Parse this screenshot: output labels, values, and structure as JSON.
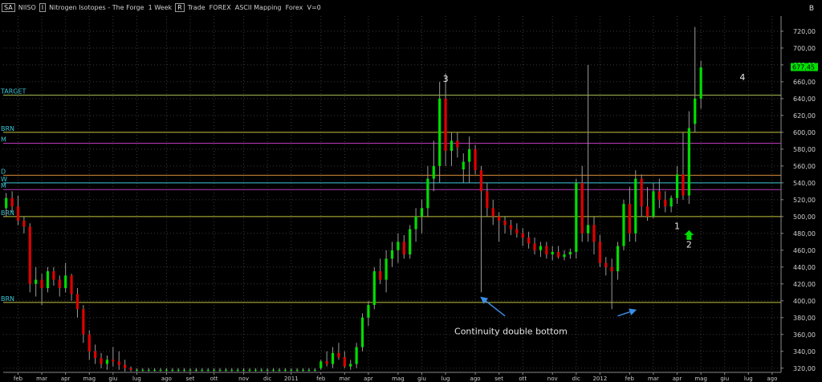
{
  "toolbar": {
    "symbol_box": "SA",
    "symbol": "NIISO",
    "name_box": "I",
    "instrument": "Nitrogen Isotopes - The Forge  1 Week",
    "mode_box": "R",
    "mode_text": "Trade  FOREX  ASCII Mapping  Forex  V=0",
    "corner": "B"
  },
  "chart_data": {
    "type": "candlestick",
    "title": "",
    "ylim": [
      315,
      738
    ],
    "y_ticks": [
      320,
      340,
      360,
      380,
      400,
      420,
      440,
      460,
      480,
      500,
      520,
      540,
      560,
      580,
      600,
      620,
      640,
      660,
      680,
      700,
      720
    ],
    "y_tick_labels": [
      "320,00",
      "340,00",
      "360,00",
      "380,00",
      "400,00",
      "420,00",
      "440,00",
      "460,00",
      "480,00",
      "500,00",
      "520,00",
      "540,00",
      "560,00",
      "580,00",
      "600,00",
      "620,00",
      "640,00",
      "660,00",
      "680,00",
      "700,00",
      "720,00"
    ],
    "last_price": {
      "value": 677.45,
      "label": "677,45",
      "color": "#00e000"
    },
    "x_labels": [
      {
        "i": 2,
        "label": "feb"
      },
      {
        "i": 6,
        "label": "mar"
      },
      {
        "i": 10,
        "label": "apr"
      },
      {
        "i": 14,
        "label": "mag"
      },
      {
        "i": 18,
        "label": "giu"
      },
      {
        "i": 22,
        "label": "lug"
      },
      {
        "i": 27,
        "label": "ago"
      },
      {
        "i": 31,
        "label": "set"
      },
      {
        "i": 35,
        "label": "ott"
      },
      {
        "i": 40,
        "label": "nov"
      },
      {
        "i": 44,
        "label": "dic"
      },
      {
        "i": 48,
        "label": "2011"
      },
      {
        "i": 53,
        "label": "feb"
      },
      {
        "i": 57,
        "label": "mar"
      },
      {
        "i": 61,
        "label": "apr"
      },
      {
        "i": 66,
        "label": "mag"
      },
      {
        "i": 70,
        "label": "giu"
      },
      {
        "i": 74,
        "label": "lug"
      },
      {
        "i": 79,
        "label": "ago"
      },
      {
        "i": 83,
        "label": "set"
      },
      {
        "i": 87,
        "label": "ott"
      },
      {
        "i": 92,
        "label": "nov"
      },
      {
        "i": 96,
        "label": "dic"
      },
      {
        "i": 100,
        "label": "2012"
      },
      {
        "i": 105,
        "label": "feb"
      },
      {
        "i": 109,
        "label": "mar"
      },
      {
        "i": 113,
        "label": "apr"
      },
      {
        "i": 117,
        "label": "mag"
      },
      {
        "i": 121,
        "label": "giu"
      },
      {
        "i": 125,
        "label": "lug"
      },
      {
        "i": 129,
        "label": "ago"
      }
    ],
    "ohlc": [
      [
        510,
        528,
        500,
        522
      ],
      [
        522,
        530,
        505,
        512
      ],
      [
        512,
        525,
        490,
        495
      ],
      [
        495,
        500,
        480,
        488
      ],
      [
        488,
        492,
        410,
        420
      ],
      [
        420,
        440,
        405,
        425
      ],
      [
        425,
        432,
        395,
        415
      ],
      [
        415,
        440,
        410,
        435
      ],
      [
        435,
        440,
        418,
        425
      ],
      [
        425,
        430,
        405,
        415
      ],
      [
        415,
        445,
        410,
        430
      ],
      [
        430,
        432,
        400,
        408
      ],
      [
        408,
        415,
        380,
        390
      ],
      [
        390,
        395,
        350,
        360
      ],
      [
        360,
        365,
        330,
        340
      ],
      [
        340,
        348,
        325,
        332
      ],
      [
        332,
        338,
        320,
        325
      ],
      [
        325,
        335,
        318,
        330
      ],
      [
        330,
        345,
        322,
        328
      ],
      [
        328,
        340,
        318,
        324
      ],
      [
        324,
        330,
        316,
        320
      ],
      [
        320,
        322,
        316,
        318
      ],
      [
        318,
        320,
        316,
        318
      ],
      [
        318,
        320,
        316,
        318
      ],
      [
        318,
        320,
        316,
        318
      ],
      [
        318,
        320,
        316,
        318
      ],
      [
        318,
        320,
        316,
        318
      ],
      [
        318,
        320,
        316,
        318
      ],
      [
        318,
        320,
        316,
        318
      ],
      [
        318,
        320,
        316,
        318
      ],
      [
        318,
        320,
        316,
        318
      ],
      [
        318,
        320,
        316,
        318
      ],
      [
        318,
        320,
        316,
        318
      ],
      [
        318,
        320,
        316,
        318
      ],
      [
        318,
        320,
        316,
        318
      ],
      [
        318,
        320,
        316,
        318
      ],
      [
        318,
        320,
        316,
        318
      ],
      [
        318,
        320,
        316,
        318
      ],
      [
        318,
        320,
        316,
        318
      ],
      [
        318,
        320,
        316,
        318
      ],
      [
        318,
        320,
        316,
        318
      ],
      [
        318,
        320,
        316,
        318
      ],
      [
        318,
        320,
        316,
        318
      ],
      [
        318,
        320,
        316,
        318
      ],
      [
        318,
        320,
        316,
        318
      ],
      [
        318,
        320,
        316,
        318
      ],
      [
        318,
        320,
        316,
        318
      ],
      [
        318,
        320,
        316,
        318
      ],
      [
        318,
        320,
        316,
        318
      ],
      [
        318,
        320,
        316,
        318
      ],
      [
        318,
        320,
        316,
        318
      ],
      [
        318,
        320,
        316,
        318
      ],
      [
        318,
        320,
        316,
        318
      ],
      [
        320,
        330,
        318,
        328
      ],
      [
        328,
        340,
        322,
        325
      ],
      [
        325,
        345,
        320,
        338
      ],
      [
        338,
        350,
        330,
        333
      ],
      [
        333,
        340,
        320,
        322
      ],
      [
        322,
        330,
        318,
        325
      ],
      [
        325,
        350,
        320,
        345
      ],
      [
        345,
        385,
        340,
        380
      ],
      [
        380,
        400,
        370,
        395
      ],
      [
        395,
        440,
        390,
        435
      ],
      [
        435,
        450,
        420,
        425
      ],
      [
        425,
        460,
        410,
        450
      ],
      [
        450,
        470,
        440,
        460
      ],
      [
        460,
        480,
        445,
        470
      ],
      [
        470,
        478,
        450,
        455
      ],
      [
        455,
        490,
        450,
        485
      ],
      [
        485,
        510,
        470,
        500
      ],
      [
        500,
        520,
        480,
        510
      ],
      [
        510,
        560,
        500,
        545
      ],
      [
        545,
        590,
        530,
        560
      ],
      [
        560,
        660,
        540,
        640
      ],
      [
        640,
        670,
        560,
        578
      ],
      [
        578,
        600,
        560,
        590
      ],
      [
        590,
        600,
        570,
        582
      ],
      [
        556,
        575,
        540,
        565
      ],
      [
        565,
        595,
        540,
        580
      ],
      [
        580,
        585,
        550,
        555
      ],
      [
        555,
        560,
        410,
        530
      ],
      [
        530,
        540,
        500,
        510
      ],
      [
        510,
        520,
        490,
        500
      ],
      [
        500,
        505,
        470,
        495
      ],
      [
        495,
        500,
        480,
        490
      ],
      [
        490,
        496,
        478,
        485
      ],
      [
        485,
        492,
        475,
        480
      ],
      [
        480,
        486,
        465,
        475
      ],
      [
        475,
        482,
        462,
        468
      ],
      [
        468,
        475,
        455,
        460
      ],
      [
        460,
        470,
        452,
        465
      ],
      [
        465,
        470,
        450,
        455
      ],
      [
        455,
        465,
        448,
        458
      ],
      [
        458,
        465,
        450,
        452
      ],
      [
        452,
        460,
        448,
        455
      ],
      [
        455,
        462,
        450,
        458
      ],
      [
        458,
        545,
        450,
        540
      ],
      [
        540,
        560,
        470,
        480
      ],
      [
        480,
        680,
        470,
        490
      ],
      [
        490,
        500,
        455,
        470
      ],
      [
        470,
        478,
        440,
        445
      ],
      [
        445,
        452,
        430,
        440
      ],
      [
        440,
        450,
        390,
        435
      ],
      [
        435,
        470,
        425,
        465
      ],
      [
        465,
        520,
        460,
        515
      ],
      [
        515,
        535,
        470,
        480
      ],
      [
        480,
        555,
        470,
        545
      ],
      [
        545,
        550,
        500,
        512
      ],
      [
        512,
        535,
        495,
        500
      ],
      [
        500,
        540,
        498,
        530
      ],
      [
        530,
        545,
        510,
        520
      ],
      [
        520,
        530,
        505,
        512
      ],
      [
        512,
        525,
        505,
        522
      ],
      [
        522,
        560,
        515,
        550
      ],
      [
        550,
        600,
        520,
        525
      ],
      [
        525,
        625,
        515,
        605
      ],
      [
        610,
        725,
        600,
        640
      ],
      [
        640,
        685,
        628,
        677
      ]
    ],
    "levels": [
      {
        "value": 644,
        "label": "TARGET",
        "color": "#a8c254"
      },
      {
        "value": 600,
        "label": "BRN",
        "color": "#c2c23c"
      },
      {
        "value": 587,
        "label": "M",
        "color": "#b83ab8"
      },
      {
        "value": 549,
        "label": "D",
        "color": "#d88a3a"
      },
      {
        "value": 540,
        "label": "W",
        "color": "#3ac6d8"
      },
      {
        "value": 532,
        "label": "M",
        "color": "#b83ab8"
      },
      {
        "value": 500,
        "label": "BRN",
        "color": "#c2c23c"
      },
      {
        "value": 398,
        "label": "BRN",
        "color": "#c2c23c"
      }
    ],
    "wave_labels": [
      {
        "i": 74,
        "value": 660,
        "label": "3"
      },
      {
        "i": 124,
        "value": 662,
        "label": "4"
      },
      {
        "i": 113,
        "value": 485,
        "label": "1"
      },
      {
        "i": 115,
        "value": 463,
        "label": "2"
      }
    ],
    "annotation": {
      "label": "Continuity double bottom",
      "i": 85,
      "value": 385
    },
    "arrows": [
      {
        "from_i": 84,
        "from_v": 382,
        "to_i": 80,
        "to_v": 404,
        "color": "#3a8ee6"
      },
      {
        "from_i": 103,
        "from_v": 382,
        "to_i": 106,
        "to_v": 389,
        "color": "#3a8ee6"
      },
      {
        "at_i": 115,
        "at_v": 478,
        "color": "#00dd00",
        "direction": "up"
      }
    ],
    "colors": {
      "bull": "#00dd00",
      "bear": "#e00000",
      "grid": "#3a3a3a",
      "axis_text": "#cfcfcf",
      "text": "#e6e6e6"
    }
  }
}
